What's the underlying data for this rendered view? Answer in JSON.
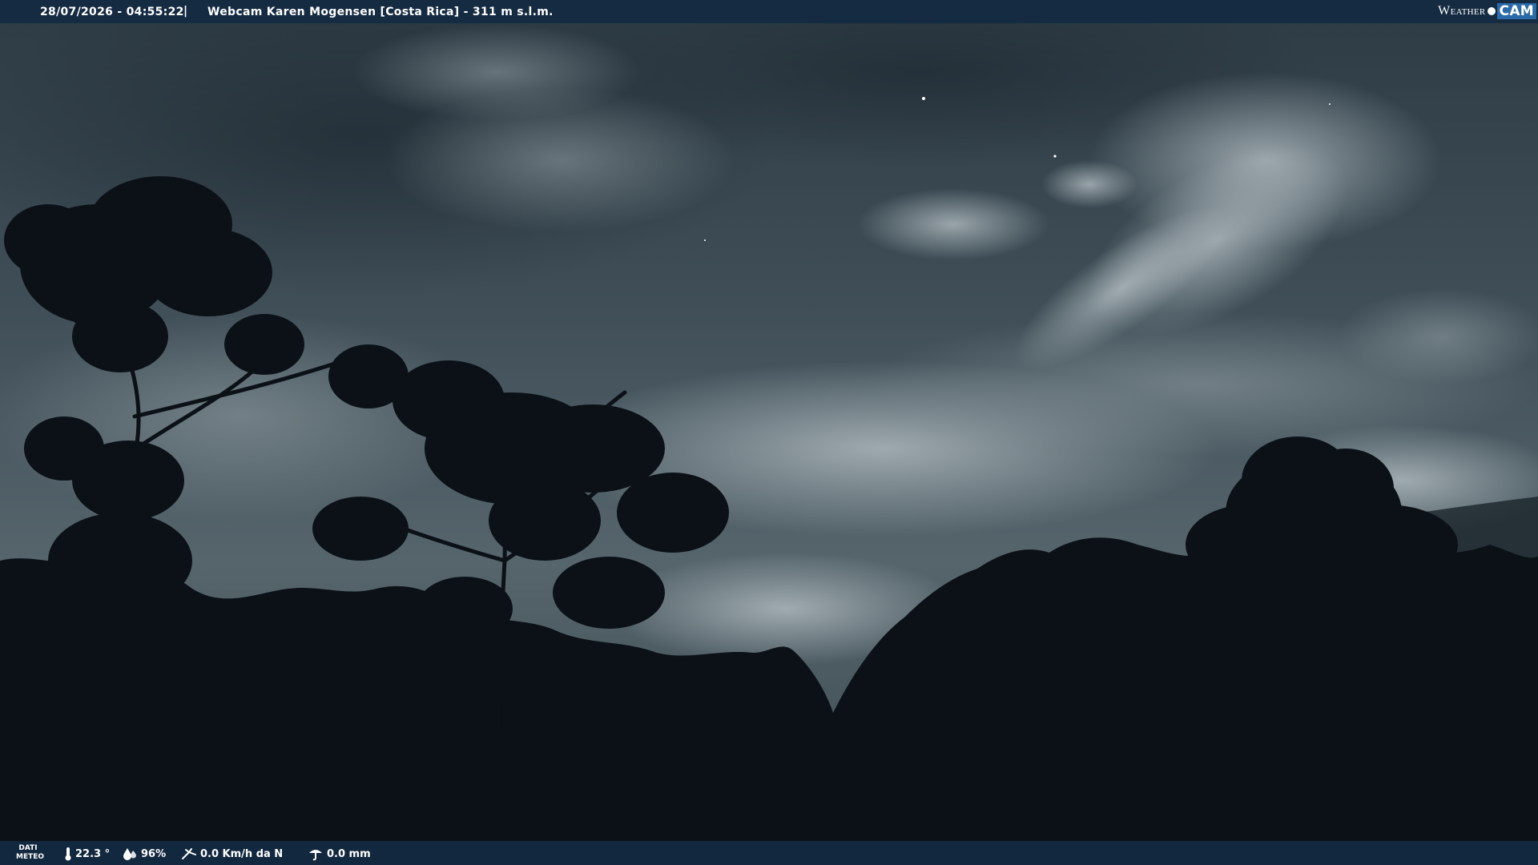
{
  "header": {
    "timestamp": "28/07/2026 - 04:55:22",
    "separator": "|",
    "title": "Webcam Karen Mogensen [Costa Rica]  - 311 m s.l.m.",
    "brand_part1": "Weather",
    "brand_part2": "CAM"
  },
  "footer": {
    "label_line1": "DATI",
    "label_line2": "METEO",
    "temperature": "22.3 °",
    "humidity": "96%",
    "wind": "0.0 Km/h da N",
    "rain": "0.0 mm"
  },
  "icons": {
    "temperature": "thermometer-icon",
    "humidity": "humidity-icon",
    "wind": "wind-icon",
    "rain": "rain-icon",
    "brand_dot": "logo-dot-icon"
  },
  "colors": {
    "bar_bg": "#142a42",
    "brand_accent": "#2a6ba8",
    "sky": "#4a5860",
    "foliage": "#0b1116"
  }
}
